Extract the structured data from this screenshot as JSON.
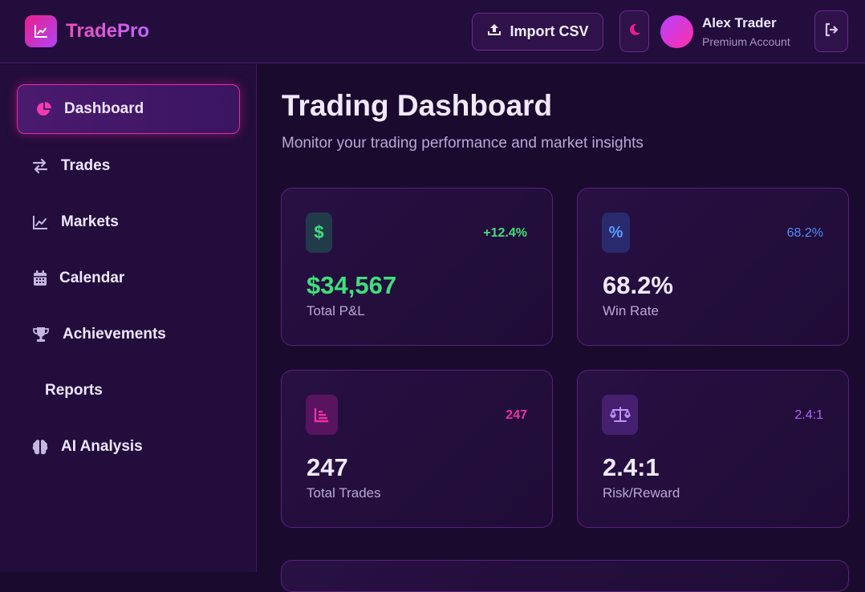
{
  "brand": {
    "name": "TradePro",
    "icon": "chart-line-icon"
  },
  "header": {
    "import_label": "Import CSV",
    "import_icon": "upload-icon",
    "theme_icon": "moon-icon",
    "logout_icon": "logout-icon",
    "user": {
      "name": "Alex Trader",
      "plan": "Premium Account"
    }
  },
  "sidebar": {
    "items": [
      {
        "label": "Dashboard",
        "icon": "pie-chart-icon",
        "active": true
      },
      {
        "label": "Trades",
        "icon": "exchange-icon"
      },
      {
        "label": "Markets",
        "icon": "chart-line-icon"
      },
      {
        "label": "Calendar",
        "icon": "calendar-icon"
      },
      {
        "label": "Achievements",
        "icon": "trophy-icon"
      },
      {
        "label": "Reports",
        "icon": ""
      },
      {
        "label": "AI Analysis",
        "icon": "brain-icon"
      }
    ]
  },
  "main": {
    "title": "Trading Dashboard",
    "subtitle": "Monitor your trading performance and market insights",
    "cards": [
      {
        "icon": "dollar-icon",
        "delta": "+12.4%",
        "value": "$34,567",
        "label": "Total P&L",
        "accent": "#3ee07a"
      },
      {
        "icon": "percent-icon",
        "delta": "68.2%",
        "value": "68.2%",
        "label": "Win Rate",
        "accent": "#4f8dff"
      },
      {
        "icon": "bar-chart-icon",
        "delta": "247",
        "value": "247",
        "label": "Total Trades",
        "accent": "#ef2fa9"
      },
      {
        "icon": "scale-icon",
        "delta": "2.4:1",
        "value": "2.4:1",
        "label": "Risk/Reward",
        "accent": "#b266ff"
      }
    ]
  },
  "colors": {
    "background": "#1a0b2e",
    "panel": "#220d3c",
    "accent_pink": "#e91e8c",
    "accent_purple": "#b044f5",
    "positive": "#3ee07a"
  }
}
